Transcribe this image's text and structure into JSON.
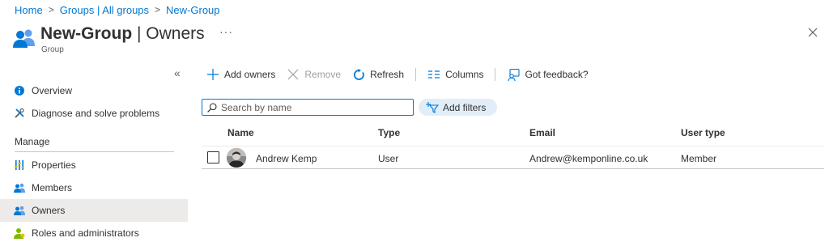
{
  "breadcrumb": {
    "home": "Home",
    "groups": "Groups | All groups",
    "group": "New-Group",
    "separator": ">"
  },
  "header": {
    "title_main": "New-Group",
    "title_sep": " | ",
    "title_page": "Owners",
    "subtitle": "Group",
    "more": "···",
    "collapse": "«"
  },
  "sidebar": {
    "items_top": [
      {
        "label": "Overview",
        "icon": "info-icon"
      },
      {
        "label": "Diagnose and solve problems",
        "icon": "tools-icon"
      }
    ],
    "section": "Manage",
    "items_manage": [
      {
        "label": "Properties",
        "icon": "properties-icon"
      },
      {
        "label": "Members",
        "icon": "members-icon"
      },
      {
        "label": "Owners",
        "icon": "owners-icon",
        "active": true
      },
      {
        "label": "Roles and administrators",
        "icon": "roles-icon"
      }
    ]
  },
  "toolbar": {
    "add_owners": "Add owners",
    "remove": "Remove",
    "refresh": "Refresh",
    "columns": "Columns",
    "feedback": "Got feedback?"
  },
  "search": {
    "placeholder": "Search by name",
    "value": ""
  },
  "filters": {
    "add_filters": "Add filters"
  },
  "table": {
    "headers": {
      "name": "Name",
      "type": "Type",
      "email": "Email",
      "user_type": "User type"
    },
    "rows": [
      {
        "name": "Andrew Kemp",
        "type": "User",
        "email": "Andrew@kemponline.co.uk",
        "user_type": "Member"
      }
    ]
  },
  "colors": {
    "accent": "#0078d4",
    "active_nav_bg": "#edebe9",
    "filter_pill_bg": "#e1eefa"
  }
}
